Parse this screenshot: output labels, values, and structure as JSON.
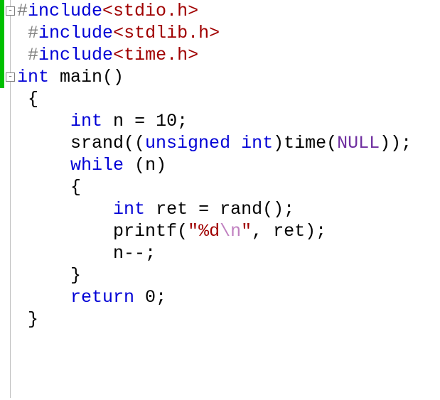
{
  "code": {
    "lines": [
      {
        "indent": "",
        "tokens": [
          {
            "cls": "directive",
            "key": "hash1"
          },
          {
            "cls": "keyword",
            "key": "include1"
          },
          {
            "cls": "header",
            "key": "hdr1"
          }
        ]
      },
      {
        "indent": " ",
        "tokens": [
          {
            "cls": "directive",
            "key": "hash2"
          },
          {
            "cls": "keyword",
            "key": "include2"
          },
          {
            "cls": "header",
            "key": "hdr2"
          }
        ]
      },
      {
        "indent": " ",
        "tokens": [
          {
            "cls": "directive",
            "key": "hash3"
          },
          {
            "cls": "keyword",
            "key": "include3"
          },
          {
            "cls": "header",
            "key": "hdr3"
          }
        ]
      },
      {
        "indent": "",
        "tokens": [
          {
            "cls": "type",
            "key": "int1"
          },
          {
            "cls": "plain",
            "key": "sp"
          },
          {
            "cls": "func",
            "key": "main"
          },
          {
            "cls": "punct",
            "key": "parens"
          }
        ]
      },
      {
        "indent": " ",
        "tokens": [
          {
            "cls": "punct",
            "key": "lbrace"
          }
        ]
      },
      {
        "indent": "     ",
        "tokens": [
          {
            "cls": "type",
            "key": "int2"
          },
          {
            "cls": "plain",
            "key": "sp"
          },
          {
            "cls": "ident",
            "key": "n"
          },
          {
            "cls": "plain",
            "key": "sp"
          },
          {
            "cls": "punct",
            "key": "eq"
          },
          {
            "cls": "plain",
            "key": "sp"
          },
          {
            "cls": "number",
            "key": "ten"
          },
          {
            "cls": "punct",
            "key": "semi"
          }
        ]
      },
      {
        "indent": "     ",
        "tokens": [
          {
            "cls": "ident",
            "key": "srand"
          },
          {
            "cls": "punct",
            "key": "op2"
          },
          {
            "cls": "keyword2",
            "key": "unsigned"
          },
          {
            "cls": "plain",
            "key": "sp"
          },
          {
            "cls": "keyword2",
            "key": "int3"
          },
          {
            "cls": "punct",
            "key": "cp"
          },
          {
            "cls": "ident",
            "key": "time"
          },
          {
            "cls": "punct",
            "key": "op"
          },
          {
            "cls": "null",
            "key": "NULL"
          },
          {
            "cls": "punct",
            "key": "cp2semi"
          }
        ]
      },
      {
        "indent": "     ",
        "tokens": [
          {
            "cls": "keyword",
            "key": "while"
          },
          {
            "cls": "plain",
            "key": "sp"
          },
          {
            "cls": "punct",
            "key": "op"
          },
          {
            "cls": "ident",
            "key": "n"
          },
          {
            "cls": "punct",
            "key": "cp"
          }
        ]
      },
      {
        "indent": "     ",
        "tokens": [
          {
            "cls": "punct",
            "key": "lbrace"
          }
        ]
      },
      {
        "indent": "         ",
        "tokens": [
          {
            "cls": "type",
            "key": "int4"
          },
          {
            "cls": "plain",
            "key": "sp"
          },
          {
            "cls": "ident",
            "key": "ret"
          },
          {
            "cls": "plain",
            "key": "sp"
          },
          {
            "cls": "punct",
            "key": "eq"
          },
          {
            "cls": "plain",
            "key": "sp"
          },
          {
            "cls": "ident",
            "key": "rand"
          },
          {
            "cls": "punct",
            "key": "callsemi"
          }
        ]
      },
      {
        "indent": "         ",
        "tokens": [
          {
            "cls": "ident",
            "key": "printf"
          },
          {
            "cls": "punct",
            "key": "op"
          },
          {
            "cls": "string",
            "key": "qopen"
          },
          {
            "cls": "string",
            "key": "pd"
          },
          {
            "cls": "escape",
            "key": "nl"
          },
          {
            "cls": "string",
            "key": "qclose"
          },
          {
            "cls": "punct",
            "key": "comma_sp"
          },
          {
            "cls": "ident",
            "key": "ret"
          },
          {
            "cls": "punct",
            "key": "cpsemi"
          }
        ]
      },
      {
        "indent": "         ",
        "tokens": [
          {
            "cls": "ident",
            "key": "n"
          },
          {
            "cls": "punct",
            "key": "mm"
          },
          {
            "cls": "punct",
            "key": "semi"
          }
        ]
      },
      {
        "indent": "     ",
        "tokens": [
          {
            "cls": "punct",
            "key": "rbrace"
          }
        ]
      },
      {
        "indent": "     ",
        "tokens": [
          {
            "cls": "keyword",
            "key": "return"
          },
          {
            "cls": "plain",
            "key": "sp"
          },
          {
            "cls": "number",
            "key": "zero"
          },
          {
            "cls": "punct",
            "key": "semi"
          }
        ]
      },
      {
        "indent": " ",
        "tokens": [
          {
            "cls": "punct",
            "key": "rbrace"
          }
        ]
      }
    ],
    "tokens": {
      "hash1": "#",
      "hash2": "#",
      "hash3": "#",
      "include1": "include",
      "include2": "include",
      "include3": "include",
      "hdr1": "<stdio.h>",
      "hdr2": "<stdlib.h>",
      "hdr3": "<time.h>",
      "int1": "int",
      "int2": "int",
      "int3": "int",
      "int4": "int",
      "main": "main",
      "parens": "()",
      "lbrace": "{",
      "rbrace": "}",
      "n": "n",
      "eq": "=",
      "ten": "10",
      "semi": ";",
      "srand": "srand",
      "op2": "((",
      "unsigned": "unsigned",
      "cp": ")",
      "op": "(",
      "time": "time",
      "NULL": "NULL",
      "cp2semi": "));",
      "while": "while",
      "ret": "ret",
      "rand": "rand",
      "callsemi": "();",
      "printf": "printf",
      "qopen": "\"",
      "pd": "%d",
      "nl": "\\n",
      "qclose": "\"",
      "comma_sp": ", ",
      "cpsemi": ");",
      "mm": "--",
      "return": "return",
      "zero": "0",
      "sp": " "
    }
  },
  "fold": {
    "boxes": [
      {
        "line": 0,
        "glyph": "-"
      },
      {
        "line": 3,
        "glyph": "-"
      }
    ]
  }
}
